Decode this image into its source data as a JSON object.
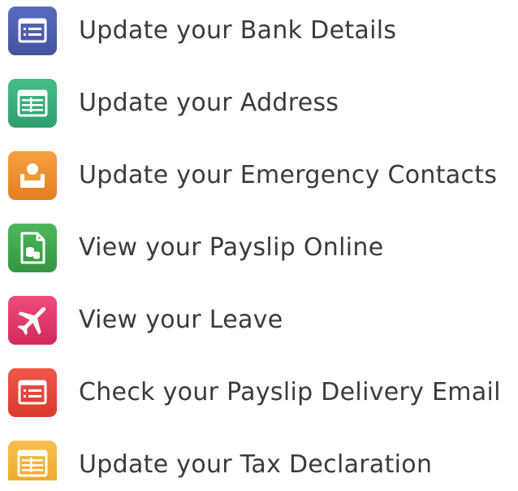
{
  "menu": {
    "items": [
      {
        "label": "Update your Bank Details",
        "icon": "form-list-icon",
        "color": "#4E5FAE"
      },
      {
        "label": "Update your Address",
        "icon": "address-table-icon",
        "color": "#3AAE78"
      },
      {
        "label": "Update your Emergency Contacts",
        "icon": "contact-person-icon",
        "color": "#EE8A2C"
      },
      {
        "label": "View your Payslip Online",
        "icon": "payslip-document-icon",
        "color": "#3FA84E"
      },
      {
        "label": "View your Leave",
        "icon": "airplane-icon",
        "color": "#E0386A"
      },
      {
        "label": "Check your Payslip Delivery Email",
        "icon": "email-list-icon",
        "color": "#E8483A"
      },
      {
        "label": "Update your Tax Declaration",
        "icon": "tax-table-icon",
        "color": "#F2B33A"
      }
    ]
  }
}
